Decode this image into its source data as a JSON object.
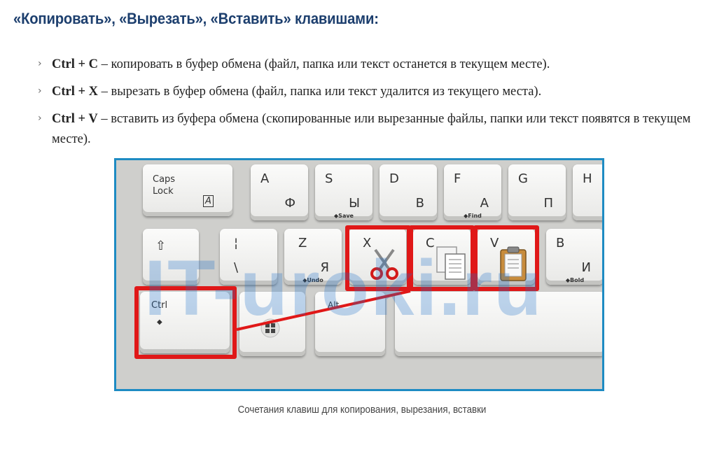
{
  "heading": "«Копировать», «Вырезать», «Вставить» клавишами:",
  "shortcuts": [
    {
      "keys": "Ctrl + C",
      "desc": " – копировать в буфер обмена (файл, папка или текст останется в текущем месте)."
    },
    {
      "keys": "Ctrl + X",
      "desc": " – вырезать в буфер обмена (файл, папка или текст удалится из текущего места)."
    },
    {
      "keys": "Ctrl + V",
      "desc": " – вставить из буфера обмена (скопированные или вырезанные файлы, папки или текст появятся в текущем месте)."
    }
  ],
  "figure": {
    "watermark": "IT-uroki.ru",
    "keys": {
      "caps": [
        "Caps",
        "Lock",
        "A"
      ],
      "a": [
        "A",
        "Ф"
      ],
      "s": [
        "S",
        "Ы",
        "◆Save"
      ],
      "d": [
        "D",
        "В"
      ],
      "f": [
        "F",
        "А",
        "◆Find"
      ],
      "g": [
        "G",
        "П"
      ],
      "h": [
        "H"
      ],
      "shift": "⇧",
      "backslash": [
        "¦",
        "\\"
      ],
      "z": [
        "Z",
        "Я",
        "◆Undo"
      ],
      "x": [
        "X"
      ],
      "c": [
        "C"
      ],
      "v": [
        "V"
      ],
      "b": [
        "B",
        "И",
        "◆Bold"
      ],
      "ctrl": [
        "Ctrl",
        "◆"
      ],
      "alt": "Alt"
    },
    "highlight_color": "#e01818",
    "border_color": "#1e8bc3"
  },
  "caption": "Сочетания клавиш для копирования, вырезания, вставки"
}
